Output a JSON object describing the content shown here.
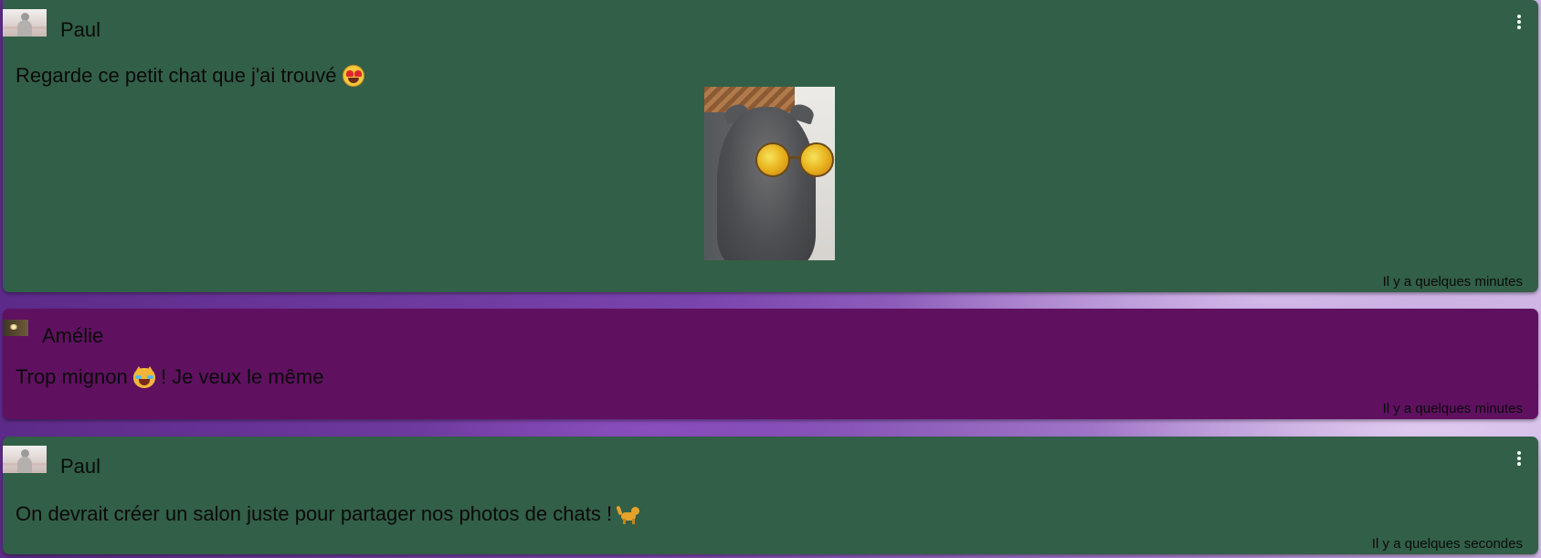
{
  "theme": {
    "card_green": "#325f47",
    "card_purple": "#5f1160",
    "menu_icon_color": "#ffffff"
  },
  "messages": [
    {
      "author": "Paul",
      "avatar": "cat-photo-avatar",
      "text": "Regarde ce petit chat que j'ai trouvé",
      "emoji": "heart-eyes-emoji",
      "attachment": "cat-with-sunglasses-photo",
      "time": "Il y a quelques minutes",
      "has_menu": true,
      "menu_icon": "more-vertical-icon"
    },
    {
      "author": "Amélie",
      "avatar": "sparkle-photo-avatar",
      "text_before": "Trop mignon",
      "emoji": "laughing-cat-emoji",
      "text_after": "! Je veux le même",
      "time": "Il y a quelques minutes",
      "has_menu": false
    },
    {
      "author": "Paul",
      "avatar": "cat-photo-avatar",
      "text": "On devrait créer un salon juste pour partager nos photos de chats !",
      "emoji": "cat-emoji",
      "time": "Il y a quelques secondes",
      "has_menu": true,
      "menu_icon": "more-vertical-icon"
    }
  ]
}
